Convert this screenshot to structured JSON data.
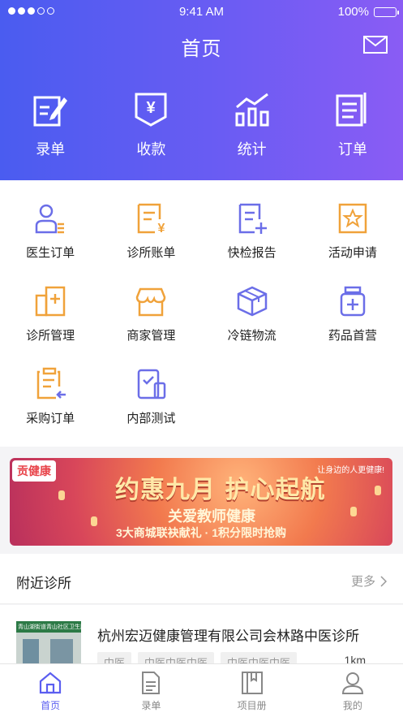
{
  "status_bar": {
    "time": "9:41 AM",
    "battery": "100%"
  },
  "header": {
    "title": "首页"
  },
  "hero_actions": [
    {
      "label": "录单",
      "icon": "edit-form-icon"
    },
    {
      "label": "收款",
      "icon": "yuan-receipt-icon"
    },
    {
      "label": "统计",
      "icon": "bar-chart-icon"
    },
    {
      "label": "订单",
      "icon": "order-list-icon"
    }
  ],
  "grid": [
    {
      "label": "医生订单",
      "icon": "doctor-icon"
    },
    {
      "label": "诊所账单",
      "icon": "bill-yuan-icon"
    },
    {
      "label": "快检报告",
      "icon": "report-add-icon"
    },
    {
      "label": "活动申请",
      "icon": "star-doc-icon"
    },
    {
      "label": "诊所管理",
      "icon": "clinic-building-icon"
    },
    {
      "label": "商家管理",
      "icon": "store-icon"
    },
    {
      "label": "冷链物流",
      "icon": "box-icon"
    },
    {
      "label": "药品首营",
      "icon": "medicine-bottle-icon"
    },
    {
      "label": "采购订单",
      "icon": "purchase-clipboard-icon"
    },
    {
      "label": "内部测试",
      "icon": "test-phone-icon"
    }
  ],
  "banner": {
    "logo": "贡健康",
    "headline": "约惠九月 护心起航",
    "subline": "关爱教师健康",
    "bottom": "3大商城联袂献礼 · 1积分限时抢购",
    "slogan": "让身边的人更健康!"
  },
  "nearby": {
    "title": "附近诊所",
    "more": "更多",
    "clinic": {
      "name": "杭州宏迈健康管理有限公司会林路中医诊所",
      "thumb_sign": "青山湖街道青山社区卫生服务站",
      "tags": [
        "中医",
        "中医中医中医",
        "中医中医中医"
      ],
      "distance": "1km"
    }
  },
  "tabbar": [
    {
      "label": "首页",
      "icon": "home-icon",
      "active": true
    },
    {
      "label": "录单",
      "icon": "document-icon",
      "active": false
    },
    {
      "label": "项目册",
      "icon": "catalog-book-icon",
      "active": false
    },
    {
      "label": "我的",
      "icon": "user-icon",
      "active": false
    }
  ],
  "colors": {
    "accent": "#5b5ef0",
    "orange": "#f0a23a",
    "purple": "#6b6ee8"
  }
}
